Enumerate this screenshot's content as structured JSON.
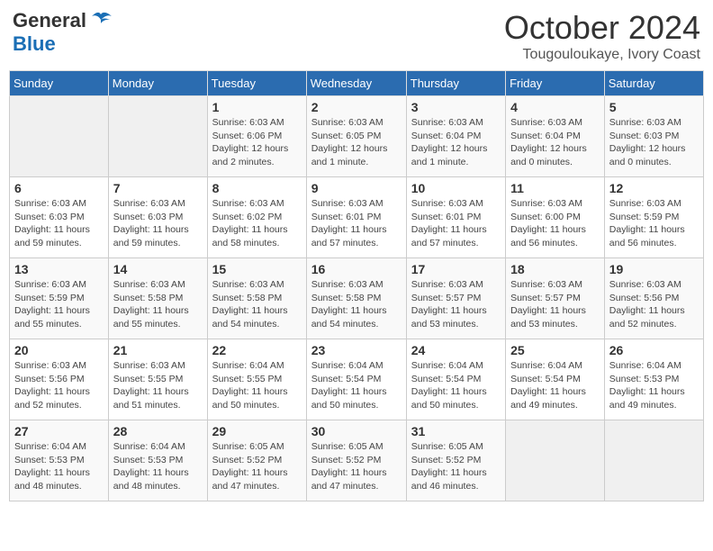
{
  "header": {
    "logo_general": "General",
    "logo_blue": "Blue",
    "month": "October 2024",
    "location": "Tougouloukaye, Ivory Coast"
  },
  "columns": [
    "Sunday",
    "Monday",
    "Tuesday",
    "Wednesday",
    "Thursday",
    "Friday",
    "Saturday"
  ],
  "weeks": [
    {
      "days": [
        {
          "num": "",
          "detail": ""
        },
        {
          "num": "",
          "detail": ""
        },
        {
          "num": "1",
          "detail": "Sunrise: 6:03 AM\nSunset: 6:06 PM\nDaylight: 12 hours\nand 2 minutes."
        },
        {
          "num": "2",
          "detail": "Sunrise: 6:03 AM\nSunset: 6:05 PM\nDaylight: 12 hours\nand 1 minute."
        },
        {
          "num": "3",
          "detail": "Sunrise: 6:03 AM\nSunset: 6:04 PM\nDaylight: 12 hours\nand 1 minute."
        },
        {
          "num": "4",
          "detail": "Sunrise: 6:03 AM\nSunset: 6:04 PM\nDaylight: 12 hours\nand 0 minutes."
        },
        {
          "num": "5",
          "detail": "Sunrise: 6:03 AM\nSunset: 6:03 PM\nDaylight: 12 hours\nand 0 minutes."
        }
      ]
    },
    {
      "days": [
        {
          "num": "6",
          "detail": "Sunrise: 6:03 AM\nSunset: 6:03 PM\nDaylight: 11 hours\nand 59 minutes."
        },
        {
          "num": "7",
          "detail": "Sunrise: 6:03 AM\nSunset: 6:03 PM\nDaylight: 11 hours\nand 59 minutes."
        },
        {
          "num": "8",
          "detail": "Sunrise: 6:03 AM\nSunset: 6:02 PM\nDaylight: 11 hours\nand 58 minutes."
        },
        {
          "num": "9",
          "detail": "Sunrise: 6:03 AM\nSunset: 6:01 PM\nDaylight: 11 hours\nand 57 minutes."
        },
        {
          "num": "10",
          "detail": "Sunrise: 6:03 AM\nSunset: 6:01 PM\nDaylight: 11 hours\nand 57 minutes."
        },
        {
          "num": "11",
          "detail": "Sunrise: 6:03 AM\nSunset: 6:00 PM\nDaylight: 11 hours\nand 56 minutes."
        },
        {
          "num": "12",
          "detail": "Sunrise: 6:03 AM\nSunset: 5:59 PM\nDaylight: 11 hours\nand 56 minutes."
        }
      ]
    },
    {
      "days": [
        {
          "num": "13",
          "detail": "Sunrise: 6:03 AM\nSunset: 5:59 PM\nDaylight: 11 hours\nand 55 minutes."
        },
        {
          "num": "14",
          "detail": "Sunrise: 6:03 AM\nSunset: 5:58 PM\nDaylight: 11 hours\nand 55 minutes."
        },
        {
          "num": "15",
          "detail": "Sunrise: 6:03 AM\nSunset: 5:58 PM\nDaylight: 11 hours\nand 54 minutes."
        },
        {
          "num": "16",
          "detail": "Sunrise: 6:03 AM\nSunset: 5:58 PM\nDaylight: 11 hours\nand 54 minutes."
        },
        {
          "num": "17",
          "detail": "Sunrise: 6:03 AM\nSunset: 5:57 PM\nDaylight: 11 hours\nand 53 minutes."
        },
        {
          "num": "18",
          "detail": "Sunrise: 6:03 AM\nSunset: 5:57 PM\nDaylight: 11 hours\nand 53 minutes."
        },
        {
          "num": "19",
          "detail": "Sunrise: 6:03 AM\nSunset: 5:56 PM\nDaylight: 11 hours\nand 52 minutes."
        }
      ]
    },
    {
      "days": [
        {
          "num": "20",
          "detail": "Sunrise: 6:03 AM\nSunset: 5:56 PM\nDaylight: 11 hours\nand 52 minutes."
        },
        {
          "num": "21",
          "detail": "Sunrise: 6:03 AM\nSunset: 5:55 PM\nDaylight: 11 hours\nand 51 minutes."
        },
        {
          "num": "22",
          "detail": "Sunrise: 6:04 AM\nSunset: 5:55 PM\nDaylight: 11 hours\nand 50 minutes."
        },
        {
          "num": "23",
          "detail": "Sunrise: 6:04 AM\nSunset: 5:54 PM\nDaylight: 11 hours\nand 50 minutes."
        },
        {
          "num": "24",
          "detail": "Sunrise: 6:04 AM\nSunset: 5:54 PM\nDaylight: 11 hours\nand 50 minutes."
        },
        {
          "num": "25",
          "detail": "Sunrise: 6:04 AM\nSunset: 5:54 PM\nDaylight: 11 hours\nand 49 minutes."
        },
        {
          "num": "26",
          "detail": "Sunrise: 6:04 AM\nSunset: 5:53 PM\nDaylight: 11 hours\nand 49 minutes."
        }
      ]
    },
    {
      "days": [
        {
          "num": "27",
          "detail": "Sunrise: 6:04 AM\nSunset: 5:53 PM\nDaylight: 11 hours\nand 48 minutes."
        },
        {
          "num": "28",
          "detail": "Sunrise: 6:04 AM\nSunset: 5:53 PM\nDaylight: 11 hours\nand 48 minutes."
        },
        {
          "num": "29",
          "detail": "Sunrise: 6:05 AM\nSunset: 5:52 PM\nDaylight: 11 hours\nand 47 minutes."
        },
        {
          "num": "30",
          "detail": "Sunrise: 6:05 AM\nSunset: 5:52 PM\nDaylight: 11 hours\nand 47 minutes."
        },
        {
          "num": "31",
          "detail": "Sunrise: 6:05 AM\nSunset: 5:52 PM\nDaylight: 11 hours\nand 46 minutes."
        },
        {
          "num": "",
          "detail": ""
        },
        {
          "num": "",
          "detail": ""
        }
      ]
    }
  ]
}
